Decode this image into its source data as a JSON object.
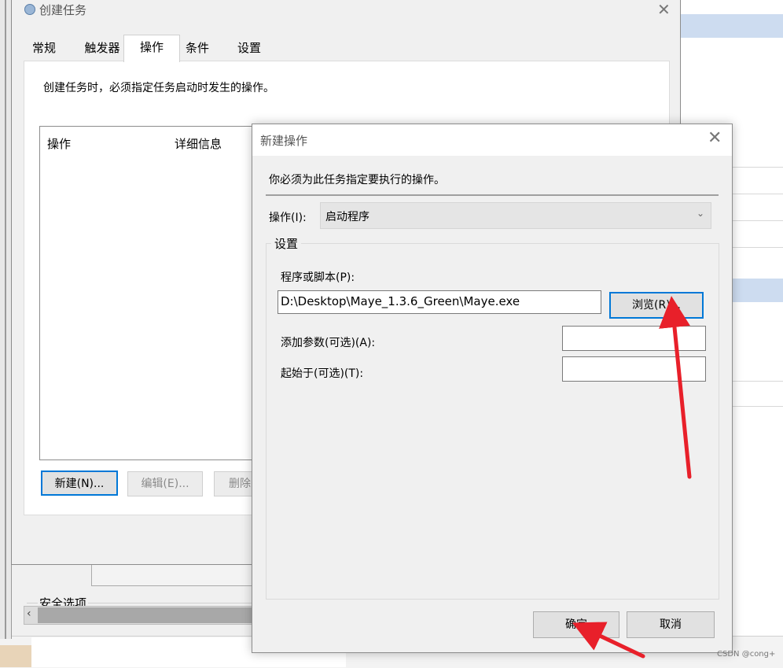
{
  "create_task": {
    "title": "创建任务",
    "close": "✕",
    "tabs": [
      "常规",
      "触发器",
      "操作",
      "条件",
      "设置"
    ],
    "description": "创建任务时，必须指定任务启动时发生的操作。",
    "list_headers": [
      "操作",
      "详细信息"
    ],
    "buttons": {
      "new": "新建(N)...",
      "edit": "编辑(E)...",
      "delete": "删除"
    },
    "security_options": "安全选项",
    "scroll_left": "‹"
  },
  "new_action": {
    "title": "新建操作",
    "close": "✕",
    "instruction": "你必须为此任务指定要执行的操作。",
    "action_label": "操作(I):",
    "action_value": "启动程序",
    "chevron": "⌄",
    "settings_group": "设置",
    "program_label": "程序或脚本(P):",
    "program_value": "D:\\Desktop\\Maye_1.3.6_Green\\Maye.exe",
    "browse": "浏览(R)...",
    "args_label": "添加参数(可选)(A):",
    "start_label": "起始于(可选)(T):",
    "ok": "确定",
    "cancel": "取消"
  },
  "watermark": "CSDN @cong+",
  "colors": {
    "accent": "#0078d7",
    "arrow": "#e8202a"
  }
}
